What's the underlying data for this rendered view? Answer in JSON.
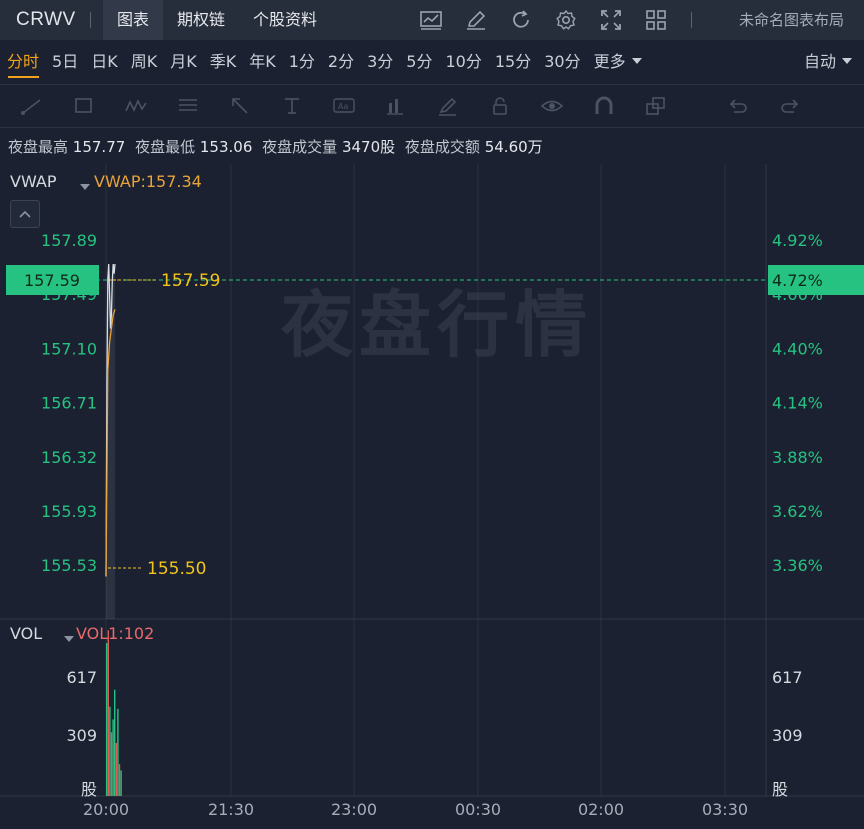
{
  "topbar": {
    "ticker": "CRWV",
    "tabs": [
      "图表",
      "期权链",
      "个股资料"
    ],
    "active_tab": 0,
    "icons": [
      "line-chart-icon",
      "pencil-icon",
      "refresh-icon",
      "gear-icon",
      "fullscreen-icon",
      "grid-icon"
    ],
    "layout_name": "未命名图表布局"
  },
  "periods": {
    "items": [
      "分时",
      "5日",
      "日K",
      "周K",
      "月K",
      "季K",
      "年K",
      "1分",
      "2分",
      "3分",
      "5分",
      "10分",
      "15分",
      "30分",
      "更多"
    ],
    "active": 0,
    "auto_label": "自动"
  },
  "drawtools": [
    "trendline-tool-icon",
    "rectangle-tool-icon",
    "pattern-tool-icon",
    "fib-tool-icon",
    "arrow-tool-icon",
    "measure-tool-icon",
    "text-tool-icon",
    "bar-pattern-tool-icon",
    "brush-tool-icon",
    "lock-icon",
    "eye-icon",
    "magnet-icon",
    "layers-icon",
    "undo-icon",
    "redo-icon"
  ],
  "stats": [
    {
      "label": "夜盘最高",
      "value": "157.77"
    },
    {
      "label": "夜盘最低",
      "value": "153.06"
    },
    {
      "label": "夜盘成交量",
      "value": "3470股"
    },
    {
      "label": "夜盘成交额",
      "value": "54.60万"
    }
  ],
  "main_indicator": {
    "name": "VWAP",
    "value_text": "VWAP:157.34"
  },
  "vol_indicator": {
    "name": "VOL",
    "value_text": "VOL1:102"
  },
  "watermark": "夜盘行情",
  "colors": {
    "up": "#26c281",
    "down": "#e05a5a",
    "vwap": "#e8a33a",
    "price_line": "#d9dde4",
    "current_price_bg": "#26c281",
    "marker": "#f0c419",
    "vol_label": "#e86a6a"
  },
  "chart_data": {
    "type": "line",
    "price_axis": {
      "left_ticks": [
        "157.89",
        "157.49",
        "157.10",
        "156.71",
        "156.32",
        "155.93",
        "155.53"
      ],
      "right_ticks": [
        "4.92%",
        "4.66%",
        "4.40%",
        "4.14%",
        "3.88%",
        "3.62%",
        "3.36%"
      ],
      "ylim": [
        155.2,
        158.25
      ]
    },
    "current_price": {
      "value": "157.59",
      "pct": "4.72%"
    },
    "markers": [
      {
        "label": "157.59",
        "value": 157.59
      },
      {
        "label": "155.50",
        "value": 155.5
      }
    ],
    "x_ticks": [
      "20:00",
      "21:30",
      "23:00",
      "00:30",
      "02:00",
      "03:30"
    ],
    "price_series": [
      {
        "t": 0.0,
        "v": 155.4
      },
      {
        "t": 0.05,
        "v": 156.8
      },
      {
        "t": 0.1,
        "v": 157.55
      },
      {
        "t": 0.15,
        "v": 157.7
      },
      {
        "t": 0.2,
        "v": 157.45
      },
      {
        "t": 0.25,
        "v": 157.2
      },
      {
        "t": 0.3,
        "v": 157.3
      },
      {
        "t": 0.35,
        "v": 157.55
      },
      {
        "t": 0.4,
        "v": 157.72
      },
      {
        "t": 0.45,
        "v": 157.6
      },
      {
        "t": 0.5,
        "v": 157.68
      }
    ],
    "vwap_series": [
      {
        "t": 0.0,
        "v": 155.4
      },
      {
        "t": 0.1,
        "v": 156.9
      },
      {
        "t": 0.2,
        "v": 157.1
      },
      {
        "t": 0.3,
        "v": 157.2
      },
      {
        "t": 0.4,
        "v": 157.3
      },
      {
        "t": 0.5,
        "v": 157.34
      }
    ],
    "volume": {
      "axis_ticks": [
        "617",
        "309",
        "股"
      ],
      "ylim": [
        0,
        800
      ],
      "bars": [
        {
          "t": 0.0,
          "v": 720,
          "dir": "up"
        },
        {
          "t": 0.08,
          "v": 780,
          "dir": "down"
        },
        {
          "t": 0.16,
          "v": 420,
          "dir": "up"
        },
        {
          "t": 0.24,
          "v": 300,
          "dir": "down"
        },
        {
          "t": 0.32,
          "v": 360,
          "dir": "up"
        },
        {
          "t": 0.4,
          "v": 500,
          "dir": "up"
        },
        {
          "t": 0.48,
          "v": 250,
          "dir": "down"
        },
        {
          "t": 0.56,
          "v": 410,
          "dir": "up"
        },
        {
          "t": 0.64,
          "v": 150,
          "dir": "down"
        },
        {
          "t": 0.72,
          "v": 120,
          "dir": "up"
        }
      ]
    }
  }
}
